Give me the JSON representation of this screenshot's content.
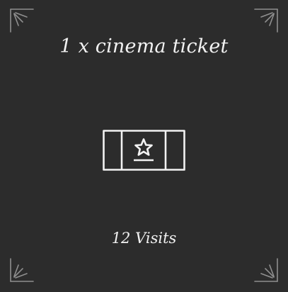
{
  "reward": {
    "title": "1 x cinema ticket",
    "icon": "ticket-star-icon",
    "visits_label": "12 Visits"
  },
  "colors": {
    "background": "#2c2c2c",
    "foreground": "#f2f2f2",
    "ornament": "#9a9a9a"
  }
}
